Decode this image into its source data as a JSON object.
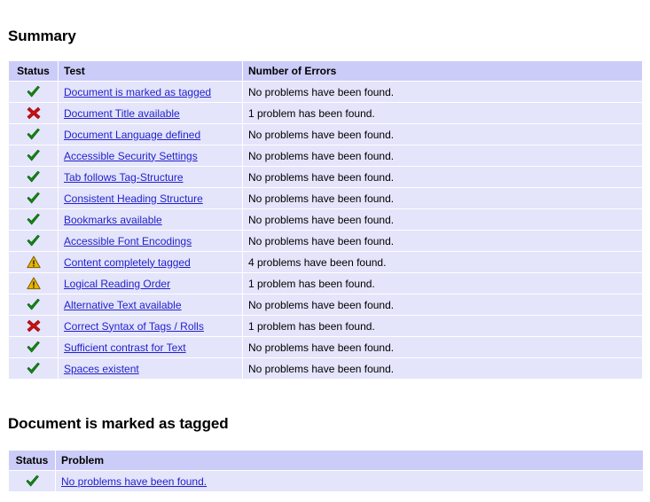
{
  "colors": {
    "header_bg": "#ccccf9",
    "row_bg": "#e4e4fb",
    "link": "#2222cc",
    "ok": "#128a12",
    "error": "#cc1111",
    "warn": "#e8b400",
    "text": "#000000",
    "page_bg": "#ffffff"
  },
  "summary": {
    "heading": "Summary",
    "columns": {
      "status": "Status",
      "test": "Test",
      "errors": "Number of Errors"
    },
    "rows": [
      {
        "status": "check-icon",
        "test": "Document is marked as tagged",
        "errors": "No problems have been found."
      },
      {
        "status": "cross-icon",
        "test": "Document Title available",
        "errors": "1 problem has been found."
      },
      {
        "status": "check-icon",
        "test": "Document Language defined",
        "errors": "No problems have been found."
      },
      {
        "status": "check-icon",
        "test": "Accessible Security Settings",
        "errors": "No problems have been found."
      },
      {
        "status": "check-icon",
        "test": "Tab follows Tag-Structure",
        "errors": "No problems have been found."
      },
      {
        "status": "check-icon",
        "test": "Consistent Heading Structure",
        "errors": "No problems have been found."
      },
      {
        "status": "check-icon",
        "test": "Bookmarks available",
        "errors": "No problems have been found."
      },
      {
        "status": "check-icon",
        "test": "Accessible Font Encodings",
        "errors": "No problems have been found."
      },
      {
        "status": "warning-icon",
        "test": "Content completely tagged",
        "errors": "4 problems have been found."
      },
      {
        "status": "warning-icon",
        "test": "Logical Reading Order",
        "errors": "1 problem has been found."
      },
      {
        "status": "check-icon",
        "test": "Alternative Text available",
        "errors": "No problems have been found."
      },
      {
        "status": "cross-icon",
        "test": "Correct Syntax of Tags / Rolls",
        "errors": "1 problem has been found."
      },
      {
        "status": "check-icon",
        "test": "Sufficient contrast for Text",
        "errors": "No problems have been found."
      },
      {
        "status": "check-icon",
        "test": "Spaces existent",
        "errors": "No problems have been found."
      }
    ]
  },
  "detail": {
    "heading": "Document is marked as tagged",
    "columns": {
      "status": "Status",
      "problem": "Problem"
    },
    "rows": [
      {
        "status": "check-icon",
        "problem": "No problems have been found."
      }
    ]
  }
}
